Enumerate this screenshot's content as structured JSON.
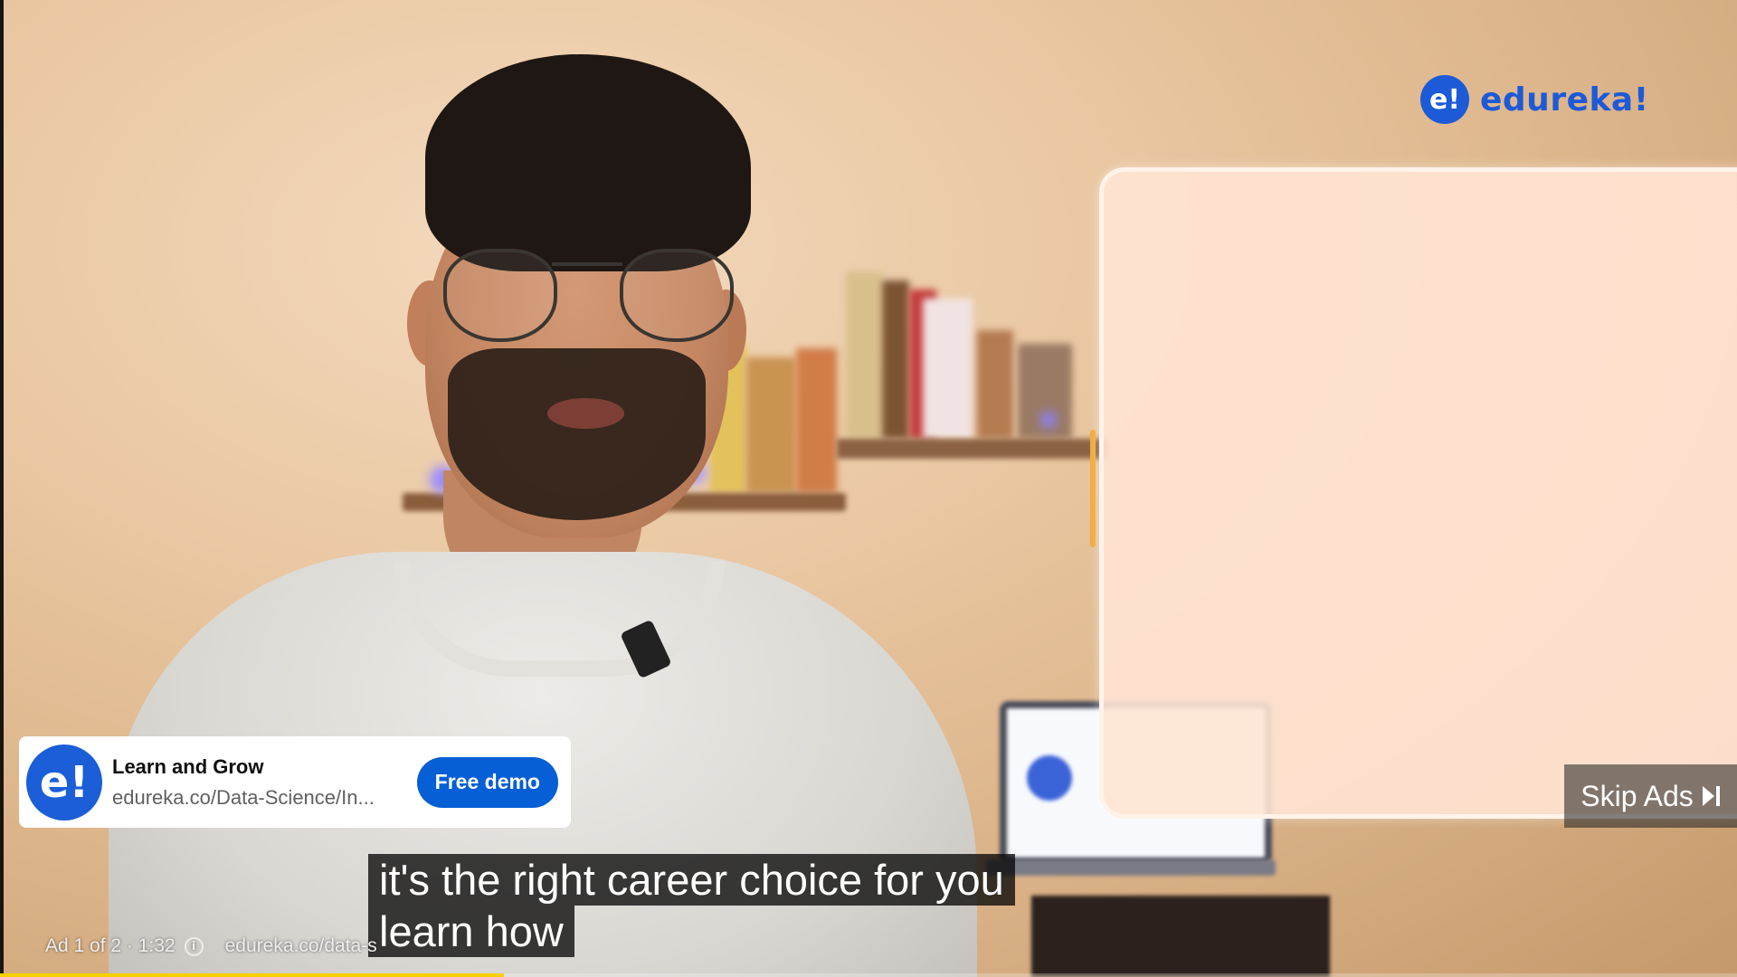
{
  "brand": {
    "mark": "e!",
    "name": "edureka!",
    "color": "#1d5ad8"
  },
  "ad_card": {
    "icon_text": "e!",
    "title": "Learn and Grow",
    "url": "edureka.co/Data-Science/In...",
    "cta_label": "Free demo",
    "cta_color": "#065fd4"
  },
  "skip": {
    "label": "Skip Ads",
    "icon": "skip-next-icon"
  },
  "captions": {
    "line1": "it's the right career choice for you",
    "line2": "learn how"
  },
  "ad_status": {
    "position": "Ad 1 of 2 · 1:32",
    "info_icon": "info-icon",
    "url": "edureka.co/data-s"
  },
  "progress": {
    "fraction": 0.29,
    "color": "#f7d000"
  }
}
